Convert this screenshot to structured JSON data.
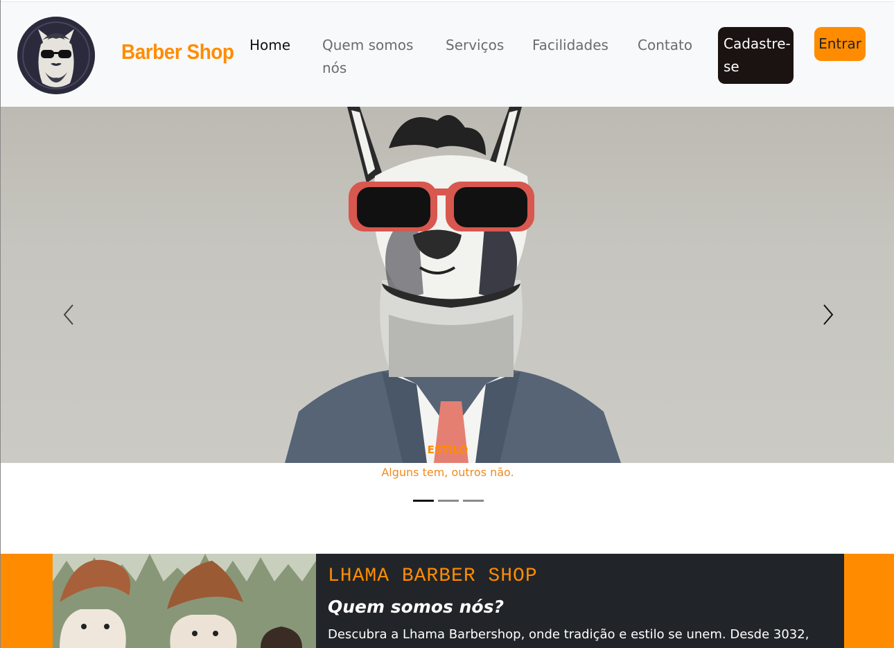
{
  "navbar": {
    "brand": "Barber Shop",
    "links": [
      {
        "label": "Home",
        "active": true
      },
      {
        "label": "Quem somos nós",
        "active": false
      },
      {
        "label": "Serviços",
        "active": false
      },
      {
        "label": "Facilidades",
        "active": false
      },
      {
        "label": "Contato",
        "active": false
      }
    ],
    "signup_label": "Cadastre-se",
    "login_label": "Entrar"
  },
  "carousel": {
    "caption_title": "ESTILO",
    "caption_subtitle": "Alguns tem, outros não.",
    "slide_count": 3,
    "active_slide": 1,
    "prev_icon": "chevron-left-icon",
    "next_icon": "chevron-right-icon"
  },
  "about": {
    "kicker": "LHAMA BARBER SHOP",
    "title": "Quem somos nós?",
    "text": "Descubra a Lhama Barbershop, onde tradição e estilo se unem. Desde 3032,"
  },
  "colors": {
    "accent": "#ff8c00",
    "dark": "#212529",
    "signup_bg": "#1a1311",
    "navbar_bg": "#f8f9fa"
  }
}
